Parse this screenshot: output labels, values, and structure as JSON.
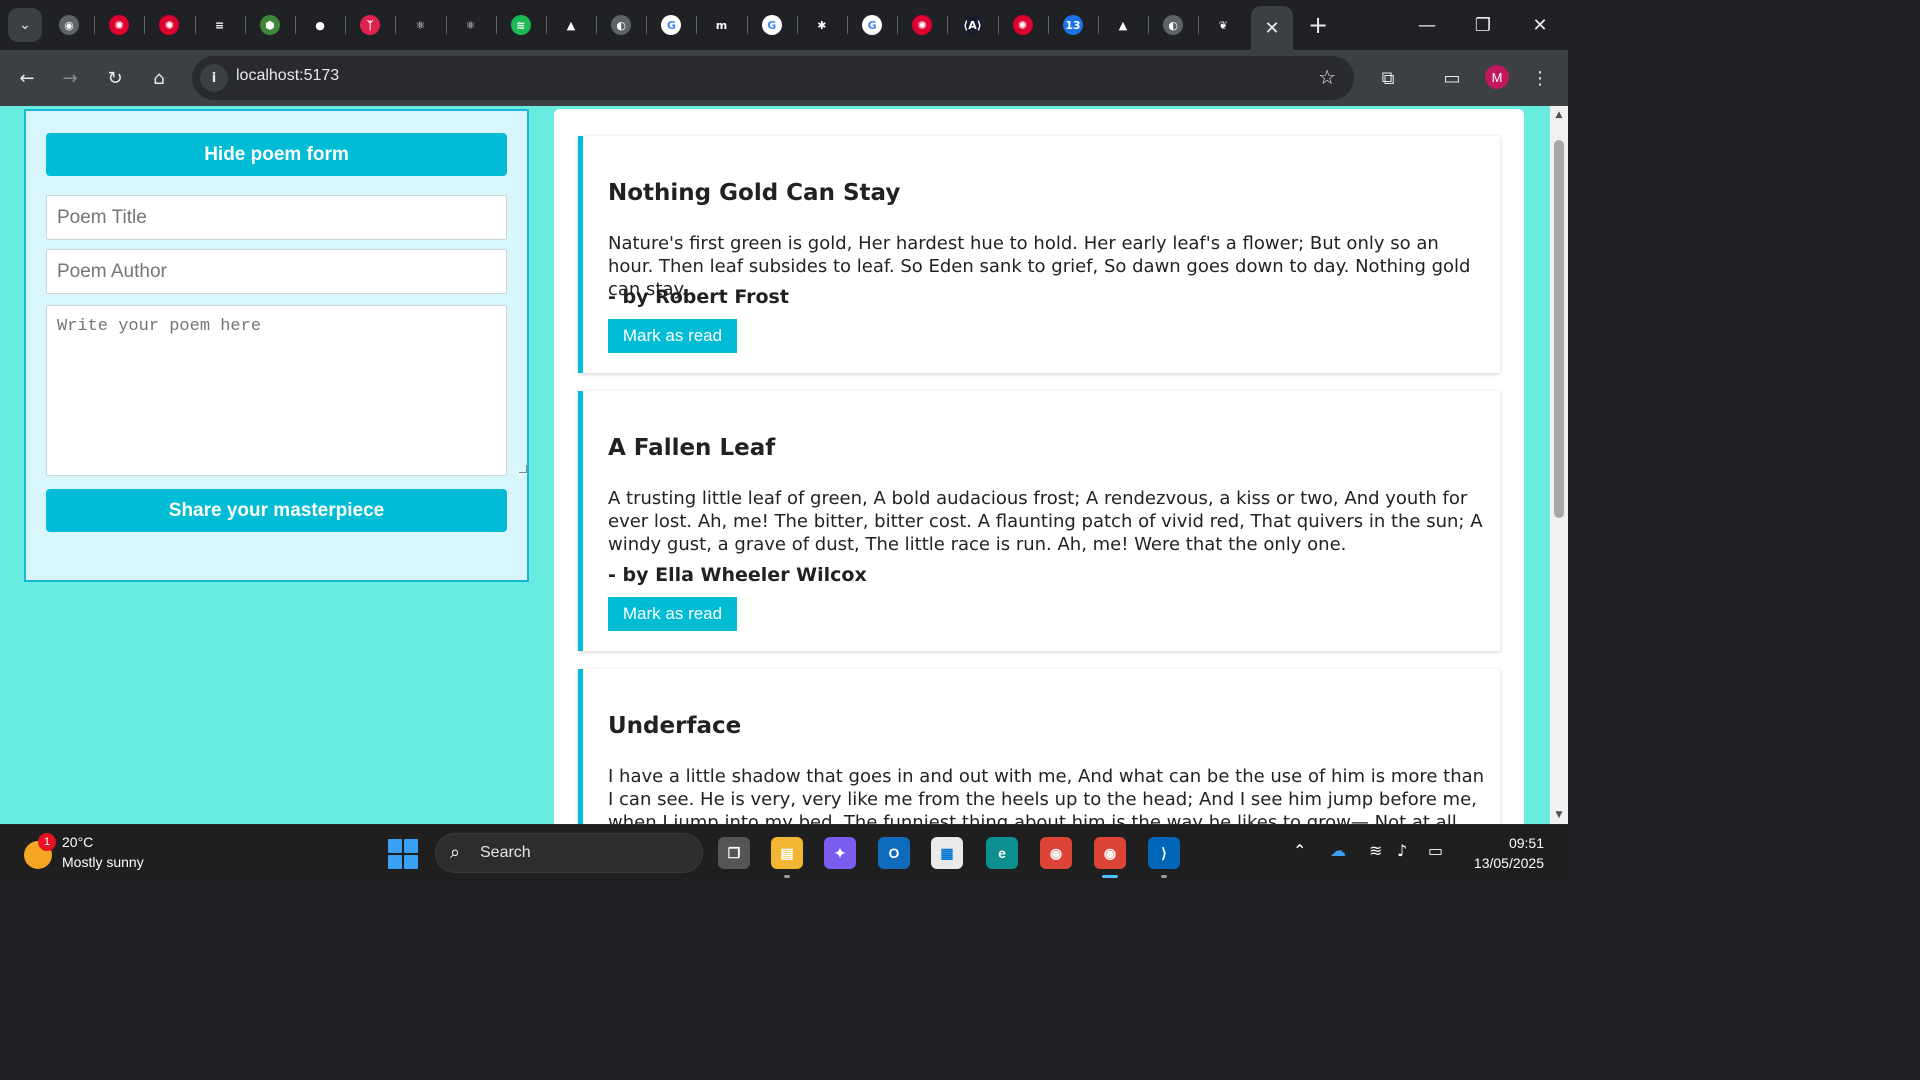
{
  "browser": {
    "url": "localhost:5173",
    "close_tab_glyph": "✕",
    "new_tab_glyph": "+",
    "profile_initial": "M",
    "pinned_tabs": [
      {
        "icon": "chrome-icon",
        "glyph": "◉",
        "color": "#5f6368"
      },
      {
        "icon": "angular-icon",
        "glyph": "✺",
        "color": "#dd0031"
      },
      {
        "icon": "angular-icon",
        "glyph": "✺",
        "color": "#dd0031"
      },
      {
        "icon": "stackshare-icon",
        "glyph": "≡",
        "color": "#202124"
      },
      {
        "icon": "nodejs-icon",
        "glyph": "⬢",
        "color": "#3c873a"
      },
      {
        "icon": "github-icon",
        "glyph": "●",
        "color": "#202124"
      },
      {
        "icon": "nest-icon",
        "glyph": "ᛉ",
        "color": "#e0234e"
      },
      {
        "icon": "react-icon",
        "glyph": "⚛",
        "color": "#202124"
      },
      {
        "icon": "react-icon",
        "glyph": "⚛",
        "color": "#202124"
      },
      {
        "icon": "spotify-icon",
        "glyph": "≋",
        "color": "#1db954"
      },
      {
        "icon": "google-drive-icon",
        "glyph": "▲",
        "color": "#202124"
      },
      {
        "icon": "globe-icon",
        "glyph": "◐",
        "color": "#5f6368"
      },
      {
        "icon": "google-icon",
        "glyph": "G",
        "color": "#ffffff"
      },
      {
        "icon": "m-brand-icon",
        "glyph": "m",
        "color": "#202124"
      },
      {
        "icon": "google-icon",
        "glyph": "G",
        "color": "#ffffff"
      },
      {
        "icon": "extension-bug-icon",
        "glyph": "✱",
        "color": "#202124"
      },
      {
        "icon": "google-icon",
        "glyph": "G",
        "color": "#ffffff"
      },
      {
        "icon": "angular-icon",
        "glyph": "✺",
        "color": "#dd0031"
      },
      {
        "icon": "devtools-icon",
        "glyph": "⟨A⟩",
        "color": "#1a1a2e"
      },
      {
        "icon": "angular-icon",
        "glyph": "✺",
        "color": "#dd0031"
      },
      {
        "icon": "google-calendar-icon",
        "glyph": "13",
        "color": "#1a73e8"
      },
      {
        "icon": "google-drive-icon",
        "glyph": "▲",
        "color": "#202124"
      },
      {
        "icon": "globe-icon",
        "glyph": "◐",
        "color": "#5f6368"
      },
      {
        "icon": "heart-app-icon",
        "glyph": "❦",
        "color": "#202124"
      }
    ]
  },
  "form": {
    "toggle_label": "Hide poem form",
    "title_placeholder": "Poem Title",
    "author_placeholder": "Poem Author",
    "body_placeholder": "Write your poem here",
    "submit_label": "Share your masterpiece"
  },
  "poems": [
    {
      "title": "Nothing Gold Can Stay",
      "text": "Nature's first green is gold, Her hardest hue to hold. Her early leaf's a flower; But only so an hour. Then leaf subsides to leaf. So Eden sank to grief, So dawn goes down to day. Nothing gold can stay.",
      "author": "- by Robert Frost",
      "button": "Mark as read"
    },
    {
      "title": "A Fallen Leaf",
      "text": "A trusting little leaf of green, A bold audacious frost; A rendezvous, a kiss or two, And youth for ever lost. Ah, me! The bitter, bitter cost. A flaunting patch of vivid red, That quivers in the sun; A windy gust, a grave of dust, The little race is run. Ah, me! Were that the only one.",
      "author": "- by Ella Wheeler Wilcox",
      "button": "Mark as read"
    },
    {
      "title": "Underface",
      "text": "I have a little shadow that goes in and out with me, And what can be the use of him is more than I can see. He is very, very like me from the heels up to the head; And I see him jump before me, when I jump into my bed. The funniest thing about him is the way he likes to grow— Not at all like proper children,",
      "author": "",
      "button": ""
    }
  ],
  "taskbar": {
    "weather_badge": "1",
    "weather_temp": "20°C",
    "weather_desc": "Mostly sunny",
    "search_label": "Search",
    "time": "09:51",
    "date": "13/05/2025"
  },
  "colors": {
    "page_bg": "#67ecdf",
    "accent": "#00bcd4",
    "form_bg": "#d8f6fb"
  }
}
